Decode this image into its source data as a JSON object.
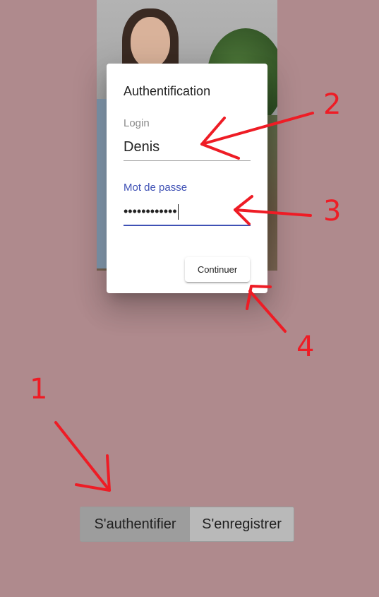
{
  "dialog": {
    "title": "Authentification",
    "login_label": "Login",
    "login_value": "Denis",
    "password_label": "Mot de passe",
    "password_value": "••••••••••••",
    "continue_label": "Continuer"
  },
  "auth_toggle": {
    "login_label": "S'authentifier",
    "register_label": "S'enregistrer"
  },
  "annotations": {
    "n1": "1",
    "n2": "2",
    "n3": "3",
    "n4": "4"
  },
  "colors": {
    "background": "#af8a8d",
    "accent": "#3f51b5",
    "annotation": "#ee1c25"
  }
}
